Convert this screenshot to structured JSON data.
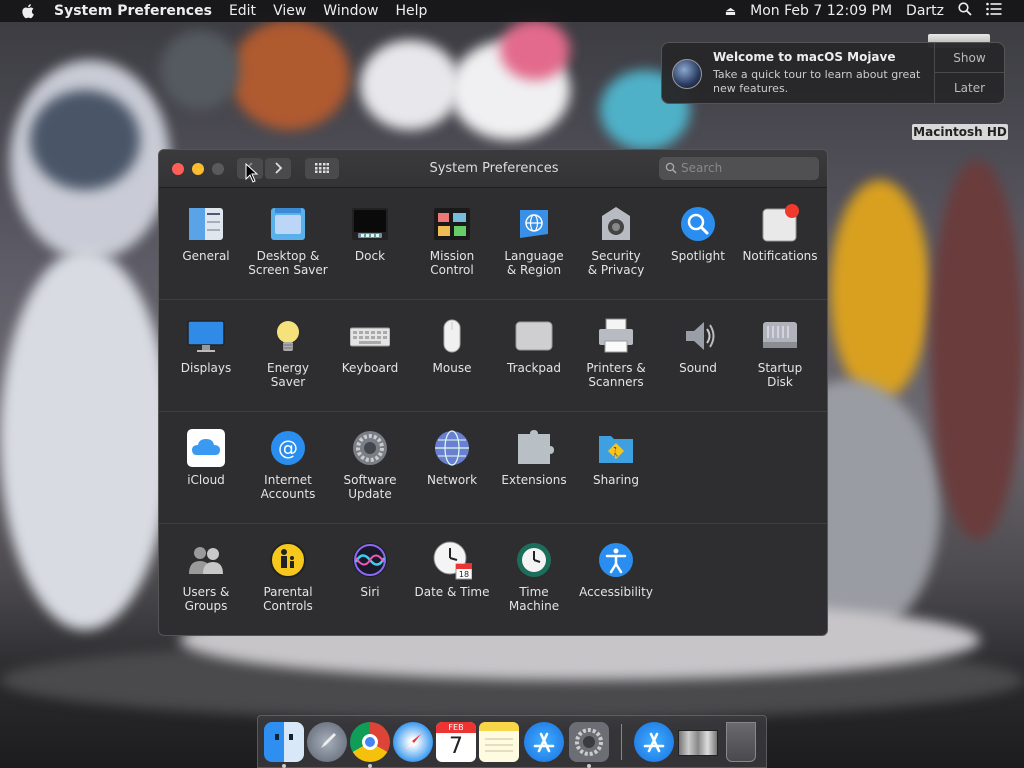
{
  "menubar": {
    "app_name": "System Preferences",
    "menus": [
      "Edit",
      "View",
      "Window",
      "Help"
    ],
    "datetime": "Mon Feb 7  12:09 PM",
    "user": "Dartz"
  },
  "notification": {
    "title": "Welcome to macOS Mojave",
    "body": "Take a quick tour to learn about great new features.",
    "show_label": "Show",
    "later_label": "Later"
  },
  "desktop": {
    "disk_label": "Macintosh HD"
  },
  "window": {
    "title": "System Preferences",
    "search_placeholder": "Search",
    "rows": [
      [
        {
          "label": "General",
          "icon": "general-icon"
        },
        {
          "label": "Desktop &\nScreen Saver",
          "icon": "desktop-screensaver-icon"
        },
        {
          "label": "Dock",
          "icon": "dock-icon"
        },
        {
          "label": "Mission\nControl",
          "icon": "mission-control-icon"
        },
        {
          "label": "Language\n& Region",
          "icon": "language-region-icon"
        },
        {
          "label": "Security\n& Privacy",
          "icon": "security-privacy-icon"
        },
        {
          "label": "Spotlight",
          "icon": "spotlight-icon"
        },
        {
          "label": "Notifications",
          "icon": "notifications-icon"
        }
      ],
      [
        {
          "label": "Displays",
          "icon": "displays-icon"
        },
        {
          "label": "Energy\nSaver",
          "icon": "energy-saver-icon"
        },
        {
          "label": "Keyboard",
          "icon": "keyboard-icon"
        },
        {
          "label": "Mouse",
          "icon": "mouse-icon"
        },
        {
          "label": "Trackpad",
          "icon": "trackpad-icon"
        },
        {
          "label": "Printers &\nScanners",
          "icon": "printers-scanners-icon"
        },
        {
          "label": "Sound",
          "icon": "sound-icon"
        },
        {
          "label": "Startup\nDisk",
          "icon": "startup-disk-icon"
        }
      ],
      [
        {
          "label": "iCloud",
          "icon": "icloud-icon"
        },
        {
          "label": "Internet\nAccounts",
          "icon": "internet-accounts-icon"
        },
        {
          "label": "Software\nUpdate",
          "icon": "software-update-icon"
        },
        {
          "label": "Network",
          "icon": "network-icon"
        },
        {
          "label": "Extensions",
          "icon": "extensions-icon"
        },
        {
          "label": "Sharing",
          "icon": "sharing-icon"
        }
      ],
      [
        {
          "label": "Users &\nGroups",
          "icon": "users-groups-icon"
        },
        {
          "label": "Parental\nControls",
          "icon": "parental-controls-icon"
        },
        {
          "label": "Siri",
          "icon": "siri-icon"
        },
        {
          "label": "Date & Time",
          "icon": "date-time-icon"
        },
        {
          "label": "Time\nMachine",
          "icon": "time-machine-icon"
        },
        {
          "label": "Accessibility",
          "icon": "accessibility-icon"
        }
      ]
    ]
  },
  "dock": {
    "items": [
      "finder-icon",
      "launchpad-icon",
      "chrome-icon",
      "safari-icon",
      "calendar-icon",
      "notes-icon",
      "app-store-icon",
      "system-preferences-icon",
      "app-store-download-icon",
      "photo-icon",
      "trash-icon"
    ],
    "calendar_month": "FEB",
    "calendar_day": "7"
  },
  "colors": {
    "window_bg": "#2e2e30",
    "menubar_bg": "#161618",
    "close": "#ff5f57",
    "minimize": "#febc2e",
    "zoom_disabled": "#5a5a5c"
  }
}
